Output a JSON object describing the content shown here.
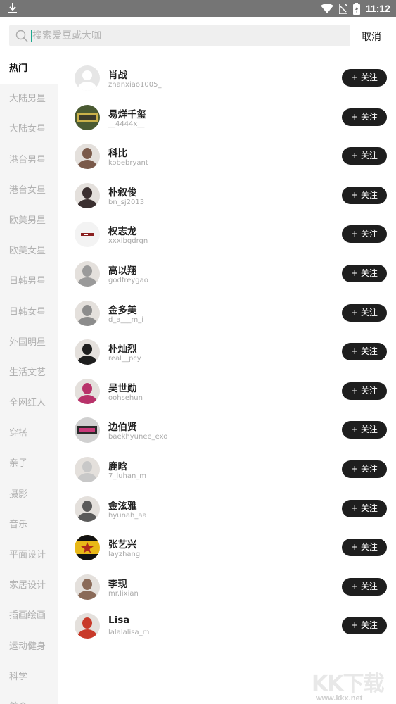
{
  "status_bar": {
    "time": "11:12"
  },
  "search": {
    "placeholder": "搜索爱豆或大咖",
    "value": "",
    "cancel_label": "取消"
  },
  "sidebar": {
    "items": [
      {
        "label": "热门"
      },
      {
        "label": "大陆男星"
      },
      {
        "label": "大陆女星"
      },
      {
        "label": "港台男星"
      },
      {
        "label": "港台女星"
      },
      {
        "label": "欧美男星"
      },
      {
        "label": "欧美女星"
      },
      {
        "label": "日韩男星"
      },
      {
        "label": "日韩女星"
      },
      {
        "label": "外国明星"
      },
      {
        "label": "生活文艺"
      },
      {
        "label": "全网红人"
      },
      {
        "label": "穿搭"
      },
      {
        "label": "亲子"
      },
      {
        "label": "摄影"
      },
      {
        "label": "音乐"
      },
      {
        "label": "平面设计"
      },
      {
        "label": "家居设计"
      },
      {
        "label": "插画绘画"
      },
      {
        "label": "运动健身"
      },
      {
        "label": "科学"
      },
      {
        "label": "美食"
      }
    ],
    "active_index": 0
  },
  "users": [
    {
      "name": "肖战",
      "handle": "zhanxiao1005_",
      "follow_label": "+ 关注",
      "avatar": "default-avatar",
      "avatar_color": "#e6e6e6"
    },
    {
      "name": "易烊千玺",
      "handle": "__4444x__",
      "follow_label": "+ 关注",
      "avatar": "sign-avatar",
      "avatar_color": "#c9b14a"
    },
    {
      "name": "科比",
      "handle": "kobebryant",
      "follow_label": "+ 关注",
      "avatar": "photo-avatar",
      "avatar_color": "#7a5a4a"
    },
    {
      "name": "朴叙俊",
      "handle": "bn_sj2013",
      "follow_label": "+ 关注",
      "avatar": "photo-avatar",
      "avatar_color": "#3b3030"
    },
    {
      "name": "权志龙",
      "handle": "xxxibgdrgn",
      "follow_label": "+ 关注",
      "avatar": "red-bar-avatar",
      "avatar_color": "#f3f3f3"
    },
    {
      "name": "高以翔",
      "handle": "godfreygao",
      "follow_label": "+ 关注",
      "avatar": "photo-avatar",
      "avatar_color": "#9a9a9a"
    },
    {
      "name": "金多美",
      "handle": "d_a___m_i",
      "follow_label": "+ 关注",
      "avatar": "photo-avatar",
      "avatar_color": "#8c8c8c"
    },
    {
      "name": "朴灿烈",
      "handle": "real__pcy",
      "follow_label": "+ 关注",
      "avatar": "photo-avatar",
      "avatar_color": "#1e1e1e"
    },
    {
      "name": "吴世勋",
      "handle": "oohsehun",
      "follow_label": "+ 关注",
      "avatar": "photo-avatar",
      "avatar_color": "#b8326a"
    },
    {
      "name": "边伯贤",
      "handle": "baekhyunee_exo",
      "follow_label": "+ 关注",
      "avatar": "logo-avatar",
      "avatar_color": "#d0d0d0"
    },
    {
      "name": "鹿晗",
      "handle": "7_luhan_m",
      "follow_label": "+ 关注",
      "avatar": "photo-avatar",
      "avatar_color": "#c8c8c8"
    },
    {
      "name": "金泫雅",
      "handle": "hyunah_aa",
      "follow_label": "+ 关注",
      "avatar": "photo-avatar",
      "avatar_color": "#5a5a5a"
    },
    {
      "name": "张艺兴",
      "handle": "layzhang",
      "follow_label": "+ 关注",
      "avatar": "star-avatar",
      "avatar_color": "#e8b818"
    },
    {
      "name": "李现",
      "handle": "mr.lixian",
      "follow_label": "+ 关注",
      "avatar": "photo-avatar",
      "avatar_color": "#8a6a58"
    },
    {
      "name": "Lisa",
      "handle": "lalalalisa_m",
      "follow_label": "+ 关注",
      "avatar": "photo-avatar",
      "avatar_color": "#c83a2a"
    }
  ],
  "watermark": {
    "text": "KK下载",
    "url": "www.kkx.net"
  },
  "colors": {
    "status_bar": "#757575",
    "sidebar_bg": "#f5f5f5",
    "follow_button": "#1e1e1e",
    "caret": "#1ea88e"
  }
}
